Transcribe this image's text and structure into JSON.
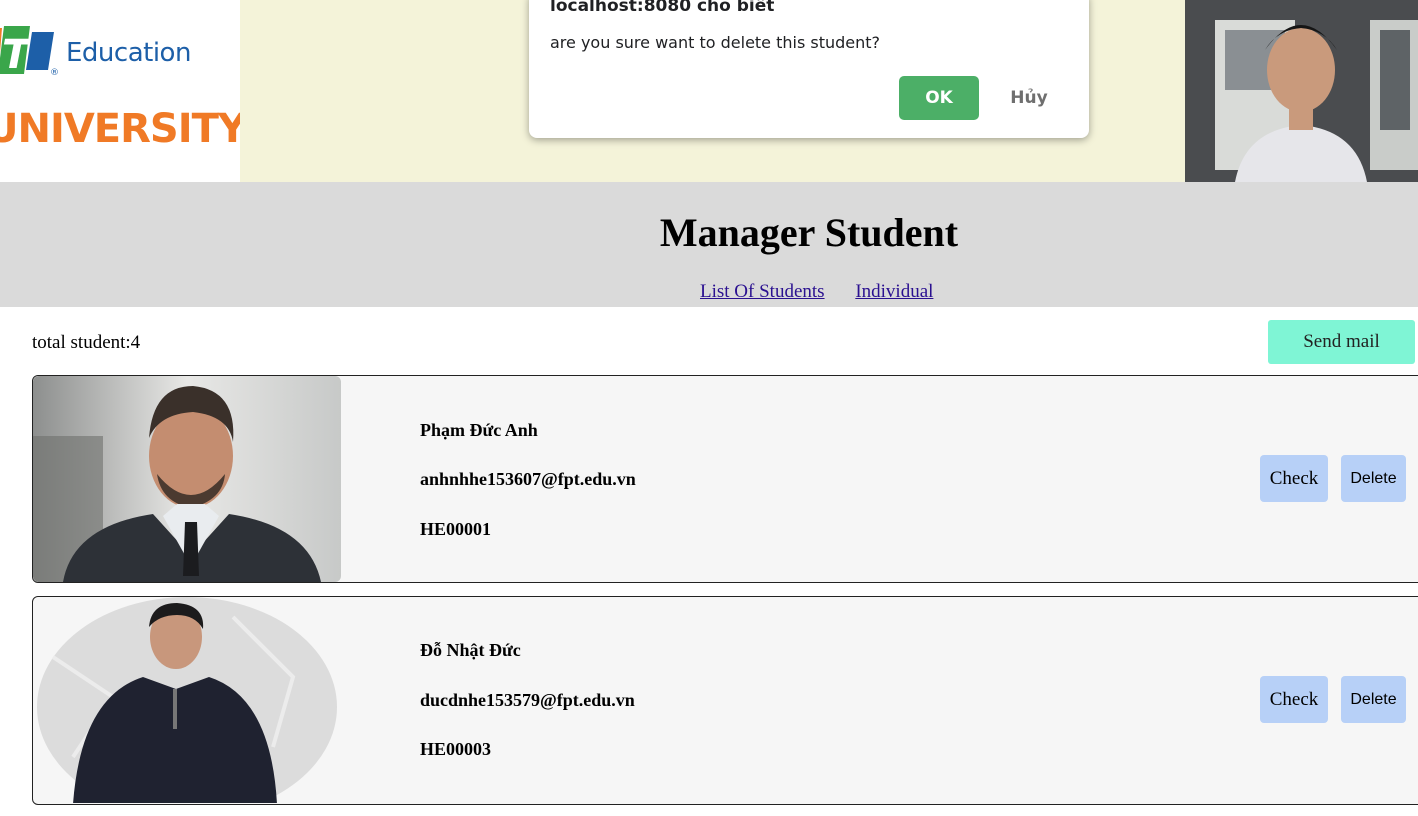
{
  "dialog": {
    "title": "localhost:8080 cho biết",
    "message": "are you sure want to delete this student?",
    "ok_label": "OK",
    "cancel_label": "Hủy"
  },
  "logo": {
    "brand": "Education",
    "university": "UNIVERSITY"
  },
  "header": {
    "title": "Manager Student",
    "nav": [
      "List Of Students",
      "Individual"
    ]
  },
  "toolbar": {
    "total_label": "total student:4",
    "send_mail_label": "Send mail"
  },
  "students": [
    {
      "name": "Phạm Đức Anh",
      "email": "anhnhhe153607@fpt.edu.vn",
      "id": "HE00001",
      "check_label": "Check",
      "delete_label": "Delete"
    },
    {
      "name": "Đỗ Nhật Đức",
      "email": "ducdnhe153579@fpt.edu.vn",
      "id": "HE00003",
      "check_label": "Check",
      "delete_label": "Delete"
    }
  ],
  "colors": {
    "banner": "#f4f3d9",
    "header": "#dadada",
    "ok": "#4caf67",
    "send_mail": "#7ff5d5",
    "card_button": "#b7d0f7"
  }
}
